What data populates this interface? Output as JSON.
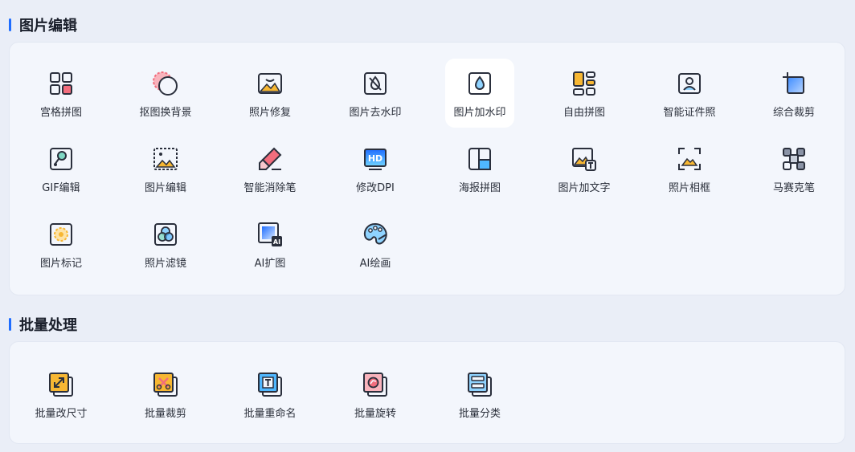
{
  "sections": {
    "edit": {
      "title": "图片编辑",
      "tools": [
        {
          "label": "宫格拼图",
          "icon": "grid-icon"
        },
        {
          "label": "抠图换背景",
          "icon": "cutout-icon"
        },
        {
          "label": "照片修复",
          "icon": "photo-repair-icon"
        },
        {
          "label": "图片去水印",
          "icon": "remove-watermark-icon"
        },
        {
          "label": "图片加水印",
          "icon": "add-watermark-icon"
        },
        {
          "label": "自由拼图",
          "icon": "free-collage-icon"
        },
        {
          "label": "智能证件照",
          "icon": "id-photo-icon"
        },
        {
          "label": "综合裁剪",
          "icon": "crop-icon"
        },
        {
          "label": "GIF编辑",
          "icon": "gif-edit-icon"
        },
        {
          "label": "图片编辑",
          "icon": "image-edit-icon"
        },
        {
          "label": "智能消除笔",
          "icon": "eraser-pen-icon"
        },
        {
          "label": "修改DPI",
          "icon": "hd-dpi-icon"
        },
        {
          "label": "海报拼图",
          "icon": "poster-collage-icon"
        },
        {
          "label": "图片加文字",
          "icon": "add-text-icon"
        },
        {
          "label": "照片相框",
          "icon": "photo-frame-icon"
        },
        {
          "label": "马赛克笔",
          "icon": "mosaic-icon"
        },
        {
          "label": "图片标记",
          "icon": "mark-icon"
        },
        {
          "label": "照片滤镜",
          "icon": "filter-icon"
        },
        {
          "label": "AI扩图",
          "icon": "ai-expand-icon"
        },
        {
          "label": "AI绘画",
          "icon": "ai-paint-palette-icon"
        }
      ]
    },
    "batch": {
      "title": "批量处理",
      "tools": [
        {
          "label": "批量改尺寸",
          "icon": "batch-resize-icon"
        },
        {
          "label": "批量裁剪",
          "icon": "batch-crop-icon"
        },
        {
          "label": "批量重命名",
          "icon": "batch-rename-icon"
        },
        {
          "label": "批量旋转",
          "icon": "batch-rotate-icon"
        },
        {
          "label": "批量分类",
          "icon": "batch-classify-icon"
        }
      ]
    }
  },
  "colors": {
    "accent": "#1f6dff",
    "icon_stroke": "#2a2f3c",
    "yellow": "#f7b733",
    "pink": "#f26d7d",
    "blue": "#3d8bff"
  }
}
